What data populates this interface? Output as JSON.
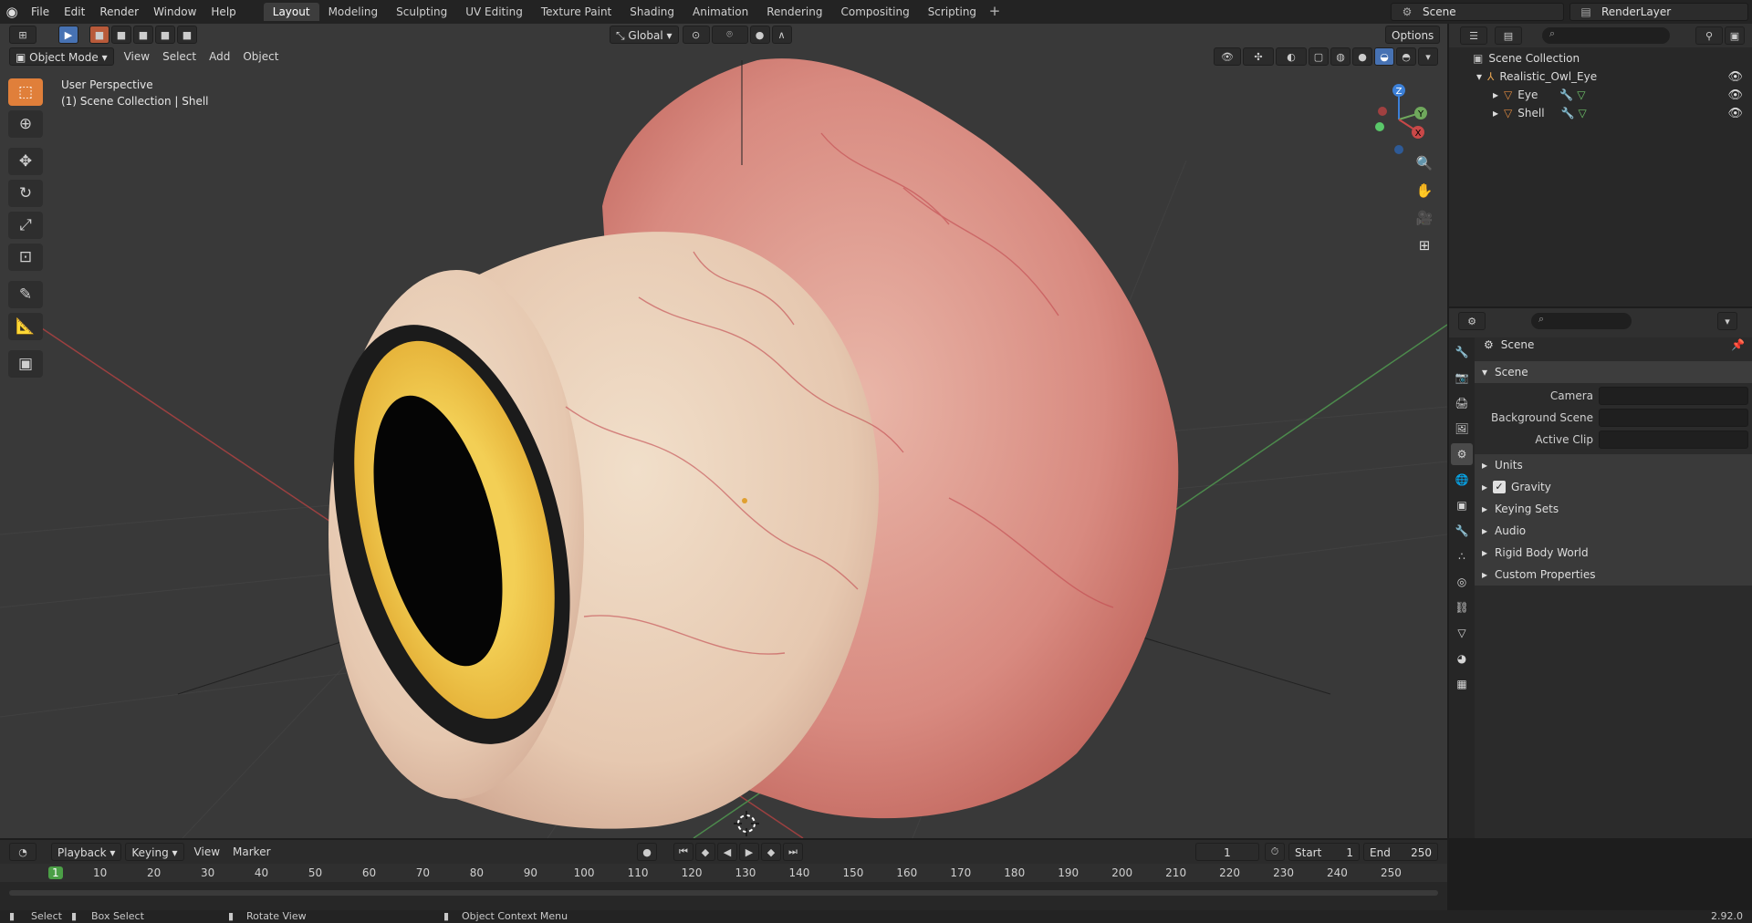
{
  "topbar": {
    "menus": [
      "File",
      "Edit",
      "Render",
      "Window",
      "Help"
    ],
    "workspaces": [
      "Layout",
      "Modeling",
      "Sculpting",
      "UV Editing",
      "Texture Paint",
      "Shading",
      "Animation",
      "Rendering",
      "Compositing",
      "Scripting"
    ],
    "active_workspace": "Layout",
    "scene": "Scene",
    "view_layer": "RenderLayer"
  },
  "viewport": {
    "mode": "Object Mode",
    "menus": [
      "View",
      "Select",
      "Add",
      "Object"
    ],
    "transform_orientation": "Global",
    "options_label": "Options",
    "perspective_label": "User Perspective",
    "collection_label": "(1) Scene Collection | Shell",
    "tools": [
      "select-box-icon",
      "cursor-icon",
      "move-icon",
      "rotate-icon",
      "scale-icon",
      "transform-icon",
      "annotate-icon",
      "measure-icon",
      "add-cube-icon"
    ]
  },
  "outliner": {
    "root": "Scene Collection",
    "items": [
      {
        "label": "Realistic_Owl_Eye",
        "depth": 1
      },
      {
        "label": "Eye",
        "depth": 2
      },
      {
        "label": "Shell",
        "depth": 2
      }
    ]
  },
  "properties": {
    "context": "Scene",
    "panel": "Scene",
    "fields": [
      {
        "label": "Camera"
      },
      {
        "label": "Background Scene"
      },
      {
        "label": "Active Clip"
      }
    ],
    "subpanels": [
      "Units",
      "Gravity",
      "Keying Sets",
      "Audio",
      "Rigid Body World",
      "Custom Properties"
    ],
    "gravity_enabled": true
  },
  "timeline": {
    "menus": [
      "Playback",
      "Keying",
      "View",
      "Marker"
    ],
    "current_frame": "1",
    "start_label": "Start",
    "start": "1",
    "end_label": "End",
    "end": "250",
    "ruler": [
      "1",
      "10",
      "20",
      "30",
      "40",
      "50",
      "60",
      "70",
      "80",
      "90",
      "100",
      "110",
      "120",
      "130",
      "140",
      "150",
      "160",
      "170",
      "180",
      "190",
      "200",
      "210",
      "220",
      "230",
      "240",
      "250"
    ]
  },
  "statusbar": {
    "select": "Select",
    "box_select": "Box Select",
    "rotate_view": "Rotate View",
    "context_menu": "Object Context Menu",
    "version": "2.92.0"
  },
  "colors": {
    "accent": "#4772b3",
    "active_tool": "#e07f3a",
    "current_frame": "#4b9f46",
    "x_axis": "#c94848",
    "y_axis": "#6fa85c",
    "z_axis": "#3c80d8"
  }
}
